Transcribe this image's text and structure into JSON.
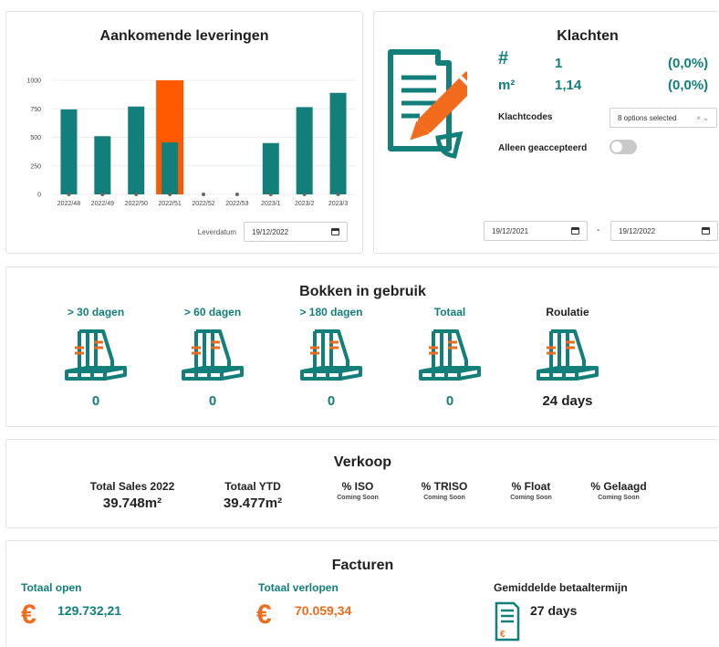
{
  "leveringen": {
    "title": "Aankomende leveringen",
    "date_label": "Leverdatum",
    "date_value": "19/12/2022"
  },
  "chart_data": {
    "type": "bar",
    "title": "Aankomende leveringen",
    "categories": [
      "2022/48",
      "2022/49",
      "2022/50",
      "2022/51",
      "2022/52",
      "2022/53",
      "2023/1",
      "2023/2",
      "2023/3"
    ],
    "values": [
      745,
      510,
      770,
      455,
      0,
      0,
      450,
      765,
      890
    ],
    "highlight": {
      "category": "2022/51",
      "value": 1000,
      "color": "#ff5a00"
    },
    "yticks": [
      0,
      250,
      500,
      750,
      1000
    ],
    "ylim": [
      0,
      1000
    ],
    "xlabel": "",
    "ylabel": "",
    "grid": true,
    "colors": {
      "bar": "#127f7a",
      "highlight": "#ff5a00"
    }
  },
  "klachten": {
    "title": "Klachten",
    "count_symbol": "#",
    "count_value": "1",
    "count_pct": "(0,0%)",
    "area_symbol": "m²",
    "area_value": "1,14",
    "area_pct": "(0,0%)",
    "codes_label": "Klachtcodes",
    "codes_value": "8 options selected",
    "accepted_label": "Alleen geaccepteerd",
    "accepted_on": false,
    "date_from": "19/12/2021",
    "date_sep": "-",
    "date_to": "19/12/2022",
    "icon": "document-pencil-icon"
  },
  "bokken": {
    "title": "Bokken in gebruik",
    "items": [
      {
        "label": "> 30 dagen",
        "value": "0"
      },
      {
        "label": "> 60 dagen",
        "value": "0"
      },
      {
        "label": "> 180 dagen",
        "value": "0"
      },
      {
        "label": "Totaal",
        "value": "0"
      },
      {
        "label": "Roulatie",
        "value": "24 days"
      }
    ]
  },
  "verkoop": {
    "title": "Verkoop",
    "items": [
      {
        "label": "Total Sales 2022",
        "value": "39.748m²"
      },
      {
        "label": "Totaal YTD",
        "value": "39.477m²"
      },
      {
        "label": "% ISO",
        "sub": "Coming Soon"
      },
      {
        "label": "% TRISO",
        "sub": "Coming Soon"
      },
      {
        "label": "% Float",
        "sub": "Coming Soon"
      },
      {
        "label": "% Gelaagd",
        "sub": "Coming Soon"
      }
    ]
  },
  "facturen": {
    "title": "Facturen",
    "open_label": "Totaal open",
    "open_value": "129.732,21",
    "overdue_label": "Totaal verlopen",
    "overdue_value": "70.059,34",
    "term_label": "Gemiddelde betaaltermijn",
    "term_value": "27 days",
    "currency": "€"
  },
  "colors": {
    "teal": "#127f7a",
    "orange": "#f26a1b"
  }
}
